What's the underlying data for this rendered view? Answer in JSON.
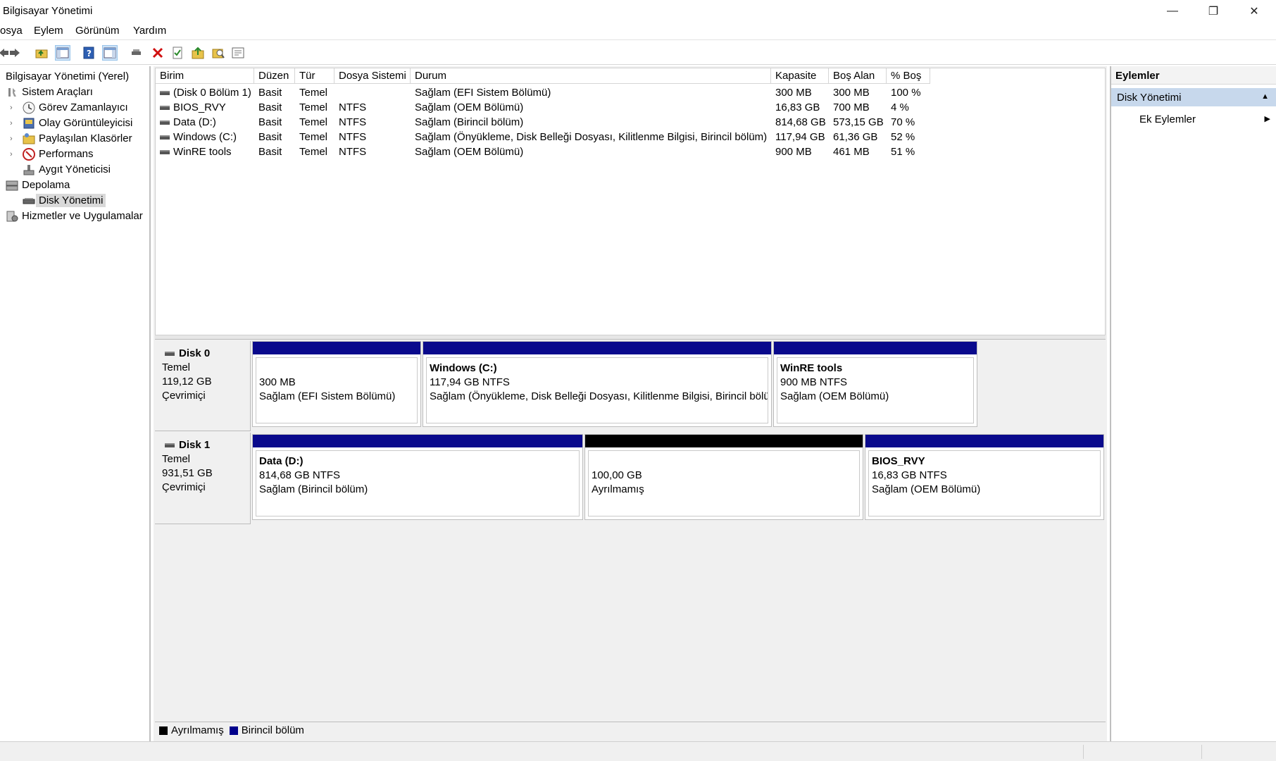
{
  "window": {
    "title": "Bilgisayar Yönetimi",
    "min_glyph": "—",
    "max_glyph": "❐",
    "close_glyph": "✕"
  },
  "menu": [
    "osya",
    "Eylem",
    "Görünüm",
    "Yardım"
  ],
  "toolbar": {
    "icons": [
      "back-icon",
      "forward-icon",
      "up-folder-icon",
      "show-hide-tree-icon",
      "help-icon",
      "show-hide-action-pane-icon",
      "connect-icon",
      "delete-icon",
      "check-icon",
      "export-icon",
      "search-icon",
      "properties-icon"
    ]
  },
  "tree": {
    "root": "Bilgisayar Yönetimi (Yerel)",
    "items": [
      {
        "label": "Sistem Araçları",
        "level": 1
      },
      {
        "label": "Görev Zamanlayıcı",
        "level": 2
      },
      {
        "label": "Olay Görüntüleyicisi",
        "level": 2
      },
      {
        "label": "Paylaşılan Klasörler",
        "level": 2
      },
      {
        "label": "Performans",
        "level": 2
      },
      {
        "label": "Aygıt Yöneticisi",
        "level": 2
      },
      {
        "label": "Depolama",
        "level": 1
      },
      {
        "label": "Disk Yönetimi",
        "level": 2
      },
      {
        "label": "Hizmetler ve Uygulamalar",
        "level": 1
      }
    ]
  },
  "volumes": {
    "columns": [
      "Birim",
      "Düzen",
      "Tür",
      "Dosya Sistemi",
      "Durum",
      "Kapasite",
      "Boş Alan",
      "% Boş"
    ],
    "rows": [
      [
        "(Disk 0 Bölüm 1)",
        "Basit",
        "Temel",
        "",
        "Sağlam (EFI Sistem Bölümü)",
        "300 MB",
        "300 MB",
        "100 %"
      ],
      [
        "BIOS_RVY",
        "Basit",
        "Temel",
        "NTFS",
        "Sağlam (OEM Bölümü)",
        "16,83 GB",
        "700 MB",
        "4 %"
      ],
      [
        "Data (D:)",
        "Basit",
        "Temel",
        "NTFS",
        "Sağlam (Birincil bölüm)",
        "814,68 GB",
        "573,15 GB",
        "70 %"
      ],
      [
        "Windows (C:)",
        "Basit",
        "Temel",
        "NTFS",
        "Sağlam (Önyükleme, Disk Belleği Dosyası, Kilitlenme Bilgisi, Birincil bölüm)",
        "117,94 GB",
        "61,36 GB",
        "52 %"
      ],
      [
        "WinRE tools",
        "Basit",
        "Temel",
        "NTFS",
        "Sağlam (OEM Bölümü)",
        "900 MB",
        "461 MB",
        "51 %"
      ]
    ]
  },
  "disks": [
    {
      "name": "Disk 0",
      "type": "Temel",
      "size": "119,12 GB",
      "status": "Çevrimiçi",
      "partitions": [
        {
          "name": "",
          "size": "300 MB",
          "status": "Sağlam (EFI Sistem Bölümü)",
          "kind": "primary"
        },
        {
          "name": "Windows  (C:)",
          "size": "117,94 GB NTFS",
          "status": "Sağlam (Önyükleme, Disk Belleği Dosyası, Kilitlenme Bilgisi, Birincil bölü",
          "kind": "primary"
        },
        {
          "name": "WinRE tools",
          "size": "900 MB NTFS",
          "status": "Sağlam (OEM Bölümü)",
          "kind": "primary"
        }
      ]
    },
    {
      "name": "Disk 1",
      "type": "Temel",
      "size": "931,51 GB",
      "status": "Çevrimiçi",
      "partitions": [
        {
          "name": "Data  (D:)",
          "size": "814,68 GB NTFS",
          "status": "Sağlam (Birincil bölüm)",
          "kind": "primary"
        },
        {
          "name": "",
          "size": "100,00 GB",
          "status": "Ayrılmamış",
          "kind": "unallocated"
        },
        {
          "name": "BIOS_RVY",
          "size": "16,83 GB NTFS",
          "status": "Sağlam (OEM Bölümü)",
          "kind": "primary"
        }
      ]
    }
  ],
  "legend": [
    {
      "label": "Ayrılmamış",
      "color": "#000000"
    },
    {
      "label": "Birincil bölüm",
      "color": "#00008b"
    }
  ],
  "colors": {
    "primary_bar": "#0a0a8c",
    "unallocated_bar": "#000000",
    "selection": "#c7d8ec"
  },
  "actions": {
    "header": "Eylemler",
    "selected": "Disk Yönetimi",
    "sub": "Ek Eylemler"
  }
}
